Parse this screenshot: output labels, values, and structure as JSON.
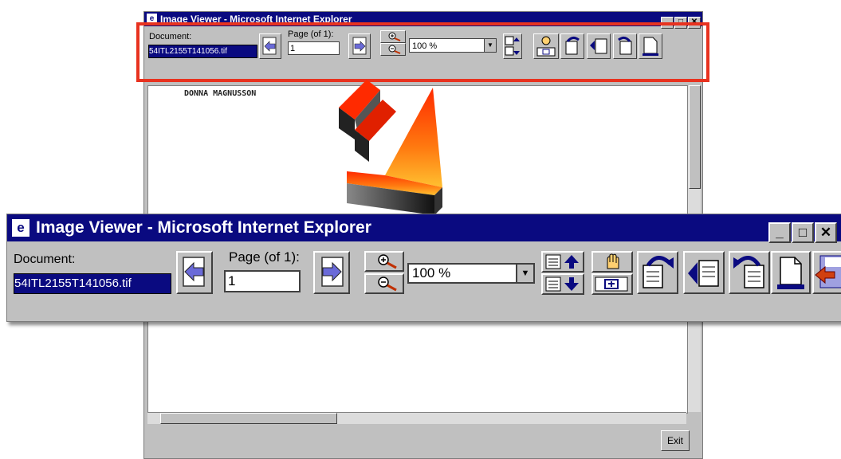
{
  "window": {
    "title": "Image Viewer - Microsoft Internet Explorer",
    "ie_glyph": "e"
  },
  "window_controls": {
    "minimize": "_",
    "maximize": "□",
    "close": "✕"
  },
  "toolbar": {
    "document_label": "Document:",
    "document_value": "54ITL2155T141056.tif",
    "page_label": "Page (of 1):",
    "page_value": "1",
    "zoom_value": "100 %",
    "dropdown_glyph": "▼"
  },
  "document": {
    "text": "DONNA MAGNUSSON"
  },
  "footer": {
    "exit_label": "Exit"
  },
  "icons": [
    "prev-page-icon",
    "next-page-icon",
    "zoom-in-icon",
    "zoom-out-icon",
    "scroll-up-icon",
    "scroll-down-icon",
    "hand-pan-icon",
    "fit-page-icon",
    "rotate-left-icon",
    "flip-icon",
    "rotate-right-icon",
    "blank-page-icon",
    "save-icon"
  ],
  "colors": {
    "titlebar": "#0a0a80",
    "highlight_frame": "#e8321f",
    "arrow_top": "#ff2a00",
    "arrow_mid": "#ffb020"
  }
}
